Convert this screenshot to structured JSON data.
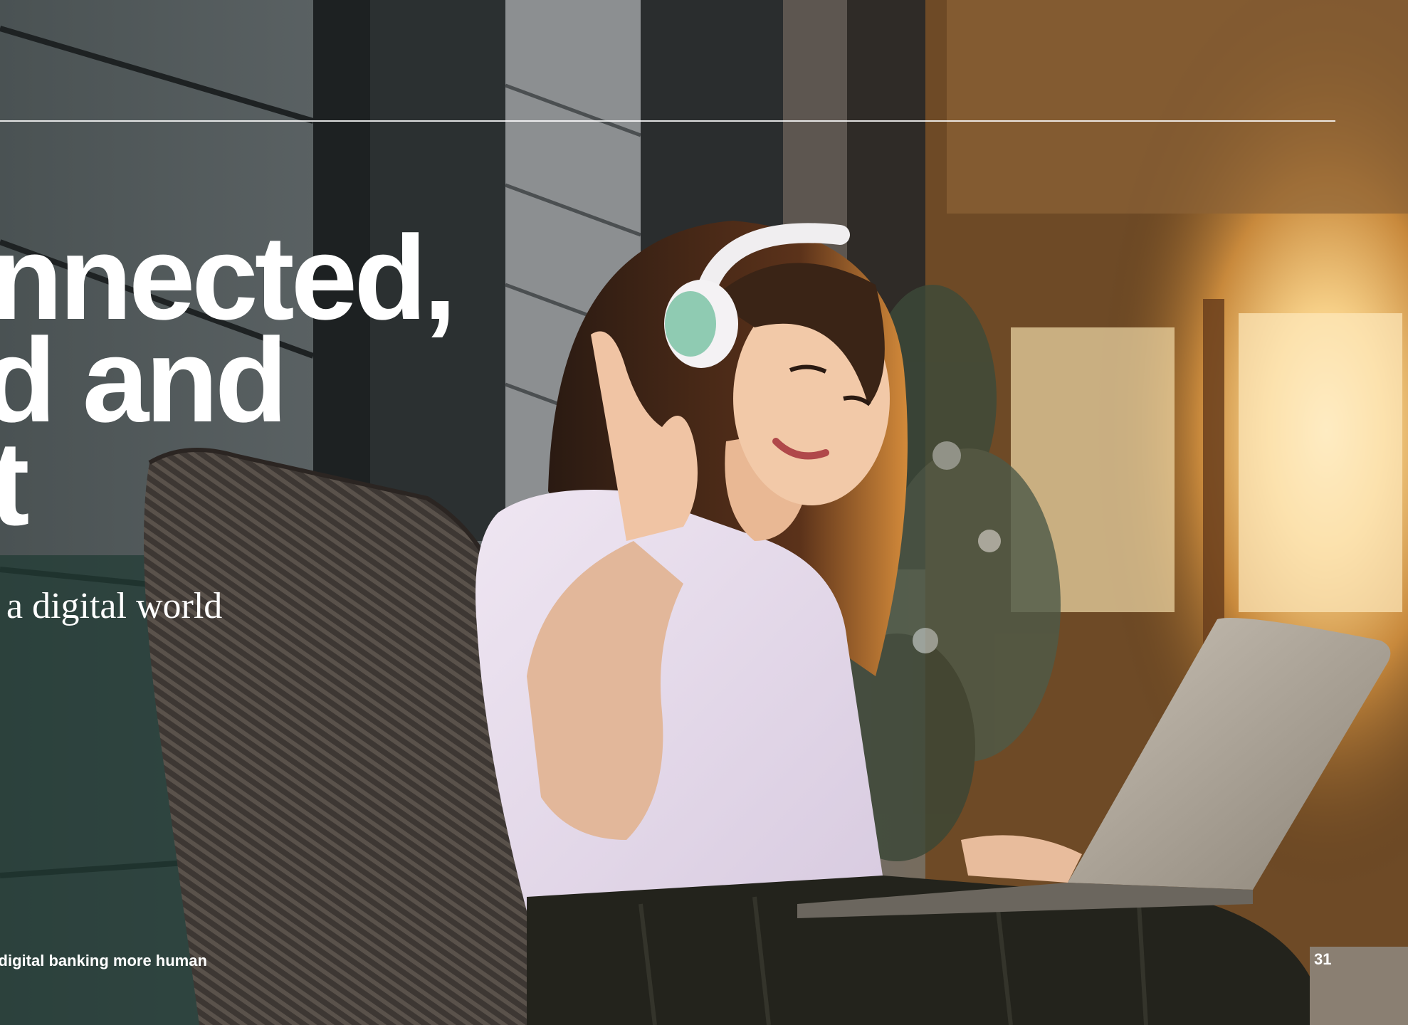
{
  "headline": {
    "line1": "onnected,",
    "line2": "ed and",
    "line3": "nt"
  },
  "subtitle": "n a digital world",
  "footer": {
    "text": "g digital banking more human",
    "page_number": "31"
  },
  "photo": {
    "description_icon": "woman-with-headphones-laptop-photo"
  },
  "colors": {
    "text": "#ffffff",
    "warm_light": "#f6c56a",
    "wall_dark": "#2f3436"
  }
}
